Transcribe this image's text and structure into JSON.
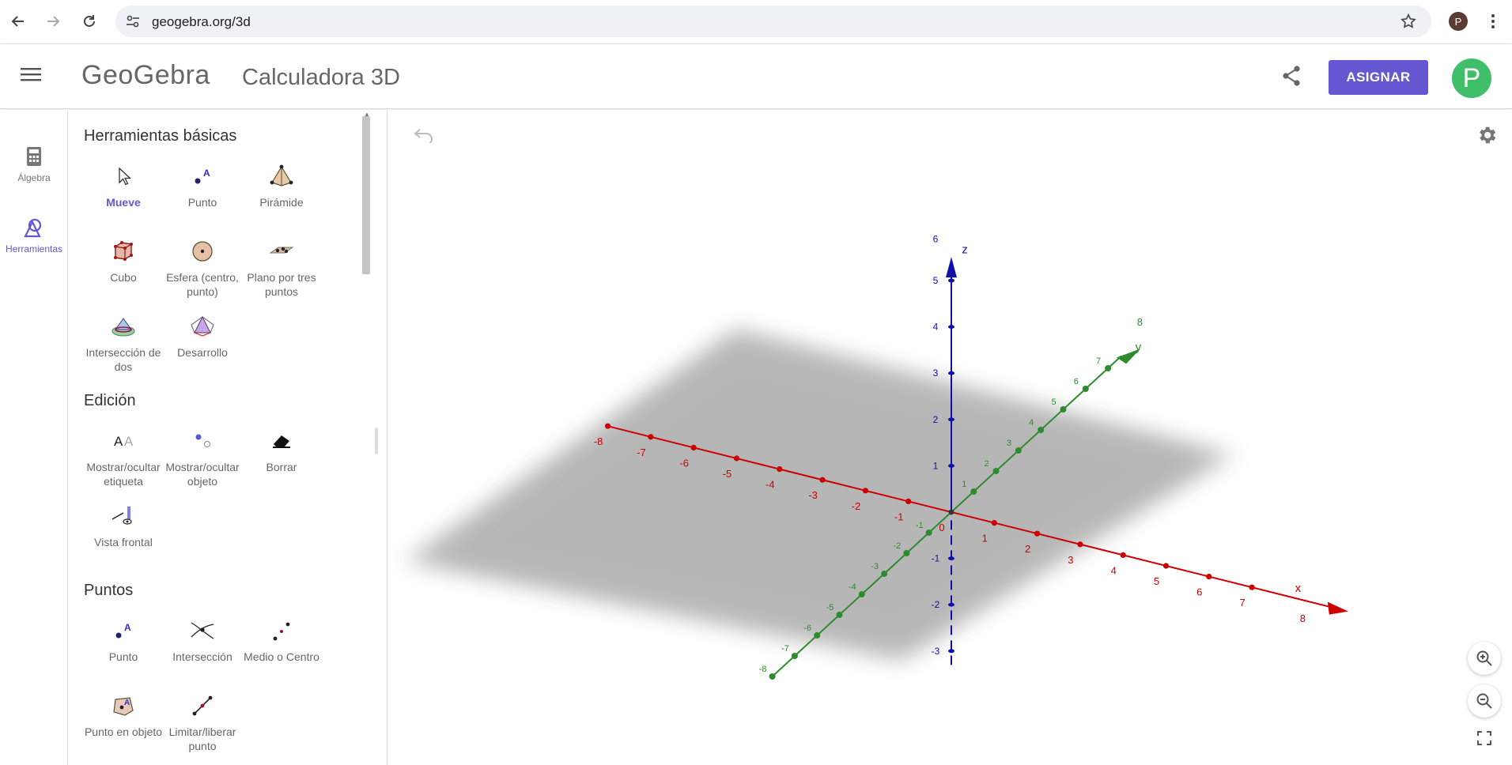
{
  "browser": {
    "url": "geogebra.org/3d",
    "profile_initial": "P"
  },
  "app": {
    "logo": "GeoGebra",
    "title": "Calculadora 3D",
    "assign_label": "ASIGNAR",
    "avatar_initial": "P"
  },
  "rail": {
    "items": [
      {
        "label": "Álgebra",
        "icon": "calculator-icon"
      },
      {
        "label": "Herramientas",
        "icon": "tools-icon"
      }
    ]
  },
  "tools": {
    "sections": [
      {
        "title": "Herramientas básicas",
        "items": [
          {
            "label": "Mueve",
            "icon": "move-arrow-icon",
            "active": true
          },
          {
            "label": "Punto",
            "icon": "point-icon"
          },
          {
            "label": "Pirámide",
            "icon": "pyramid-icon"
          },
          {
            "label": "Cubo",
            "icon": "cube-icon"
          },
          {
            "label": "Esfera (centro, punto)",
            "icon": "sphere-icon"
          },
          {
            "label": "Plano por tres puntos",
            "icon": "plane-three-points-icon"
          },
          {
            "label": "Intersección de dos",
            "icon": "intersect-surfaces-icon"
          },
          {
            "label": "Desarrollo",
            "icon": "net-icon"
          }
        ]
      },
      {
        "title": "Edición",
        "items": [
          {
            "label": "Mostrar/ocultar etiqueta",
            "icon": "show-label-icon"
          },
          {
            "label": "Mostrar/ocultar objeto",
            "icon": "show-object-icon"
          },
          {
            "label": "Borrar",
            "icon": "eraser-icon"
          },
          {
            "label": "Vista frontal",
            "icon": "view-in-front-icon"
          }
        ]
      },
      {
        "title": "Puntos",
        "items": [
          {
            "label": "Punto",
            "icon": "point-icon"
          },
          {
            "label": "Intersección",
            "icon": "intersection-icon"
          },
          {
            "label": "Medio o Centro",
            "icon": "midpoint-icon"
          },
          {
            "label": "Punto en objeto",
            "icon": "point-on-object-icon"
          },
          {
            "label": "Limitar/liberar punto",
            "icon": "attach-detach-icon"
          }
        ]
      }
    ]
  },
  "view3d": {
    "axes": {
      "x": {
        "label": "x",
        "ticks": [
          "-8",
          "-7",
          "-6",
          "-5",
          "-4",
          "-3",
          "-2",
          "-1",
          "0",
          "1",
          "2",
          "3",
          "4",
          "5",
          "6",
          "7",
          "8"
        ],
        "color": "#cc0000"
      },
      "y": {
        "label": "y",
        "ticks": [
          "-8",
          "-7",
          "-6",
          "-5",
          "-4",
          "-3",
          "-2",
          "-1",
          "1",
          "2",
          "3",
          "4",
          "5",
          "6",
          "7",
          "8"
        ],
        "color": "#2e8b2e"
      },
      "z": {
        "label": "z",
        "ticks": [
          "-3",
          "-2",
          "-1",
          "1",
          "2",
          "3",
          "4",
          "5",
          "6"
        ],
        "color": "#1010a8"
      }
    },
    "plane_color": "#b8b8b8"
  },
  "colors": {
    "accent": "#6557d2",
    "avatar": "#3fbf6a"
  }
}
